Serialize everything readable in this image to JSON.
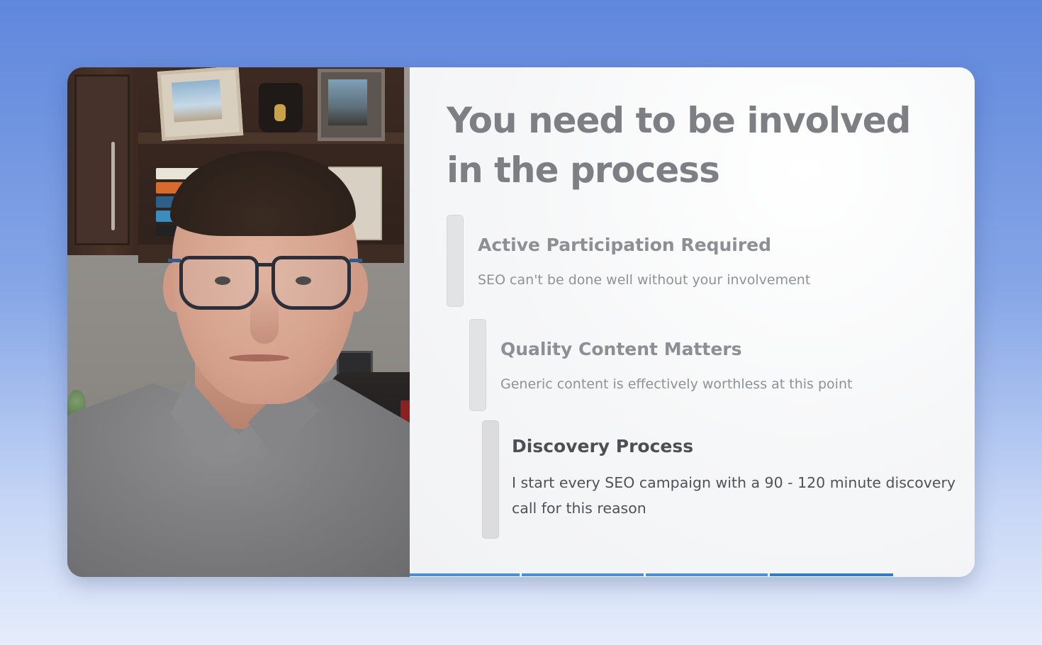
{
  "slide": {
    "title": "You need to be involved in the process",
    "points": [
      {
        "heading": "Active Participation Required",
        "body": "SEO can't be done well without your involvement"
      },
      {
        "heading": "Quality Content Matters",
        "body": "Generic content is effectively worthless at this point"
      },
      {
        "heading": "Discovery Process",
        "body": "I start every SEO campaign with a 90 - 120 minute discovery call for this reason"
      }
    ]
  },
  "progress": {
    "segments": 4,
    "current_segment": 4,
    "colors": {
      "complete": "#4a90d9",
      "active": "#2f7bd0",
      "remaining": "#d6e3f3"
    }
  },
  "colors": {
    "background_top": "#5f87dc",
    "background_bottom": "#e6edfb",
    "title_text": "#7d7f84",
    "active_text": "#4d4f54"
  }
}
